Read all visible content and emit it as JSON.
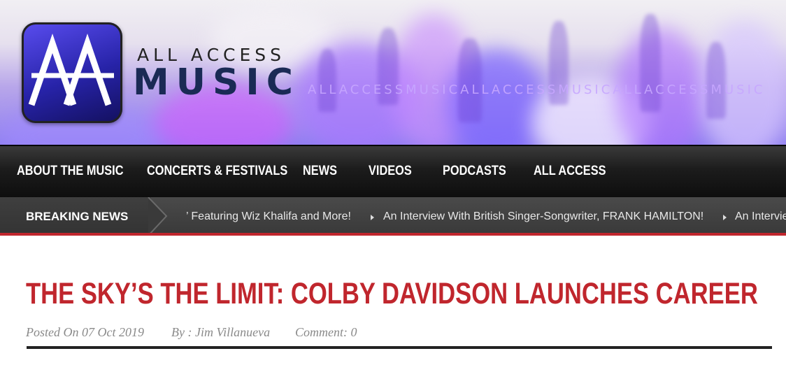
{
  "site": {
    "logo_small": "ALL ACCESS",
    "logo_big": "MUSIC",
    "tagline": "ALLACCESSMUSICALLACCESSMUSICALLACCESSMUSIC"
  },
  "nav": {
    "items": [
      {
        "label": "ABOUT THE MUSIC"
      },
      {
        "label": "CONCERTS & FESTIVALS"
      },
      {
        "label": "NEWS"
      },
      {
        "label": "VIDEOS"
      },
      {
        "label": "PODCASTS"
      },
      {
        "label": "ALL ACCESS"
      }
    ]
  },
  "breaking": {
    "label": "BREAKING NEWS",
    "items": [
      "’ Featuring Wiz Khalifa and More!",
      "An Interview With British Singer-Songwriter, FRANK HAMILTON!",
      "An Intervie"
    ]
  },
  "article": {
    "title": "THE SKY’S THE LIMIT: COLBY DAVIDSON LAUNCHES CAREER",
    "posted": "Posted On 07 Oct 2019",
    "author": "By : Jim Villanueva",
    "comments": "Comment: 0"
  },
  "colors": {
    "accent": "#c0262d",
    "nav_bg": "#111111",
    "breaking_bg": "#3d3d3d"
  }
}
